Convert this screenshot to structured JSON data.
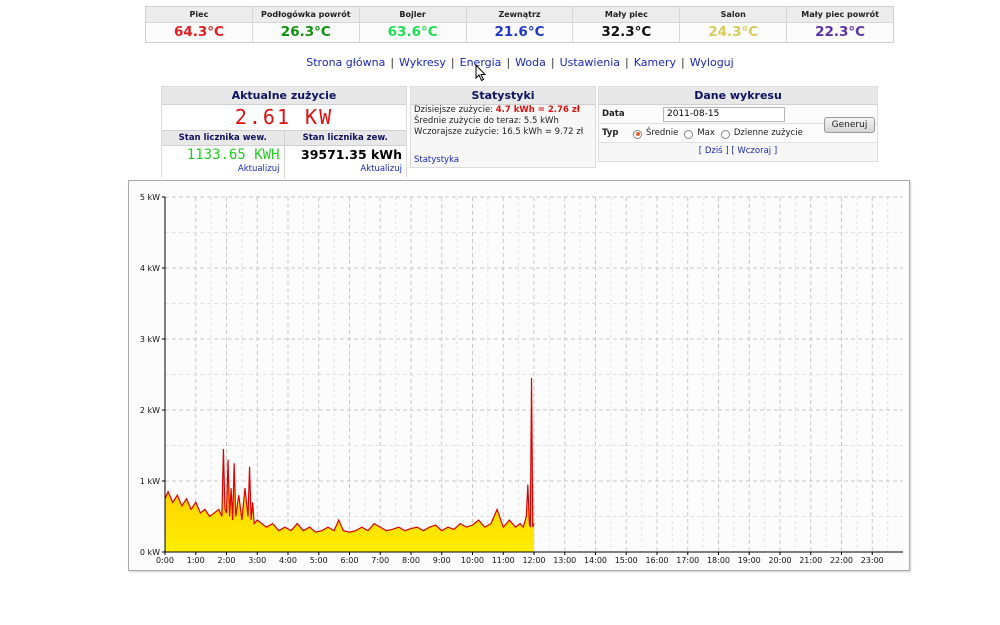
{
  "temperatures": [
    {
      "name": "Piec",
      "value": "64.3°C",
      "color": "#e02020"
    },
    {
      "name": "Podłogówka powrót",
      "value": "26.3°C",
      "color": "#109010"
    },
    {
      "name": "Bojler",
      "value": "63.6°C",
      "color": "#22dd55"
    },
    {
      "name": "Zewnątrz",
      "value": "21.6°C",
      "color": "#1f36c8"
    },
    {
      "name": "Mały piec",
      "value": "32.3°C",
      "color": "#111111"
    },
    {
      "name": "Salon",
      "value": "24.3°C",
      "color": "#d8cc5a"
    },
    {
      "name": "Mały piec powrót",
      "value": "22.3°C",
      "color": "#6030a8"
    }
  ],
  "nav": [
    "Strona główna",
    "Wykresy",
    "Energia",
    "Woda",
    "Ustawienia",
    "Kamery",
    "Wyloguj"
  ],
  "usage": {
    "title": "Aktualne zużycie",
    "current": "2.61 KW",
    "meter_internal": {
      "label": "Stan licznika wew.",
      "value": "1133.65 KWH",
      "link": "Aktualizuj"
    },
    "meter_external": {
      "label": "Stan licznika zew.",
      "value": "39571.35 kWh",
      "link": "Aktualizuj"
    }
  },
  "stats": {
    "title": "Statystyki",
    "today_label": "Dzisiejsze zużycie:",
    "today_value": "4.7 kWh = 2.76 zł",
    "avg_line": "Średnie zużycie do teraz: 5.5 kWh",
    "yesterday_line": "Wczorajsze zużycie: 16.5 kWh = 9.72 zł",
    "link": "Statystyka"
  },
  "chart_form": {
    "title": "Dane wykresu",
    "date_label": "Data",
    "date_value": "2011-08-15",
    "type_label": "Typ",
    "types": [
      "Średnie",
      "Max",
      "Dzienne zużycie"
    ],
    "selected_type": "Średnie",
    "button": "Generuj",
    "links": "[ Dziś ] [ Wczoraj ]"
  },
  "chart_data": {
    "type": "area",
    "title": "",
    "xlabel": "",
    "ylabel": "",
    "unit": "kW",
    "ylim": [
      0,
      5
    ],
    "yticks": [
      "0 kW",
      "1 kW",
      "2 kW",
      "3 kW",
      "4 kW",
      "5 kW"
    ],
    "xlim": [
      0,
      24
    ],
    "xticks": [
      "0:00",
      "1:00",
      "2:00",
      "3:00",
      "4:00",
      "5:00",
      "6:00",
      "7:00",
      "8:00",
      "9:00",
      "10:00",
      "11:00",
      "12:00",
      "13:00",
      "14:00",
      "15:00",
      "16:00",
      "17:00",
      "18:00",
      "19:00",
      "20:00",
      "21:00",
      "22:00",
      "23:00"
    ],
    "grid": true,
    "colors": {
      "line": "#dd0000",
      "fill_top": "#ffa000",
      "fill_bottom": "#ffee00"
    },
    "series": [
      {
        "x": [
          0,
          0.1,
          0.25,
          0.4,
          0.55,
          0.7,
          0.85,
          1.0,
          1.15,
          1.3,
          1.45,
          1.6,
          1.75,
          1.85,
          1.9,
          1.95,
          2.0,
          2.05,
          2.1,
          2.15,
          2.2,
          2.25,
          2.3,
          2.4,
          2.5,
          2.6,
          2.7,
          2.75,
          2.8,
          2.85,
          2.9,
          3.0,
          3.15,
          3.3,
          3.5,
          3.7,
          3.9,
          4.1,
          4.3,
          4.5,
          4.7,
          4.9,
          5.1,
          5.3,
          5.5,
          5.65,
          5.8,
          6.0,
          6.2,
          6.4,
          6.6,
          6.8,
          7.0,
          7.2,
          7.4,
          7.6,
          7.8,
          8.0,
          8.2,
          8.4,
          8.6,
          8.8,
          9.0,
          9.2,
          9.4,
          9.6,
          9.8,
          10.0,
          10.2,
          10.4,
          10.6,
          10.8,
          11.0,
          11.2,
          11.4,
          11.55,
          11.65,
          11.75,
          11.8,
          11.85,
          11.88,
          11.92,
          11.96,
          12.0
        ],
        "y": [
          0.75,
          0.85,
          0.7,
          0.8,
          0.65,
          0.75,
          0.6,
          0.7,
          0.55,
          0.6,
          0.5,
          0.55,
          0.6,
          0.5,
          1.45,
          0.6,
          0.55,
          1.3,
          0.5,
          0.9,
          0.45,
          1.25,
          0.5,
          0.8,
          0.45,
          0.9,
          0.5,
          1.2,
          0.45,
          0.7,
          0.4,
          0.45,
          0.4,
          0.35,
          0.4,
          0.3,
          0.35,
          0.3,
          0.4,
          0.3,
          0.35,
          0.28,
          0.3,
          0.35,
          0.3,
          0.45,
          0.3,
          0.28,
          0.3,
          0.35,
          0.3,
          0.4,
          0.35,
          0.3,
          0.32,
          0.35,
          0.3,
          0.33,
          0.35,
          0.3,
          0.35,
          0.38,
          0.3,
          0.35,
          0.32,
          0.4,
          0.35,
          0.38,
          0.45,
          0.35,
          0.4,
          0.6,
          0.35,
          0.45,
          0.35,
          0.4,
          0.35,
          0.5,
          0.95,
          0.4,
          0.35,
          2.45,
          0.35,
          0.4
        ]
      }
    ]
  }
}
